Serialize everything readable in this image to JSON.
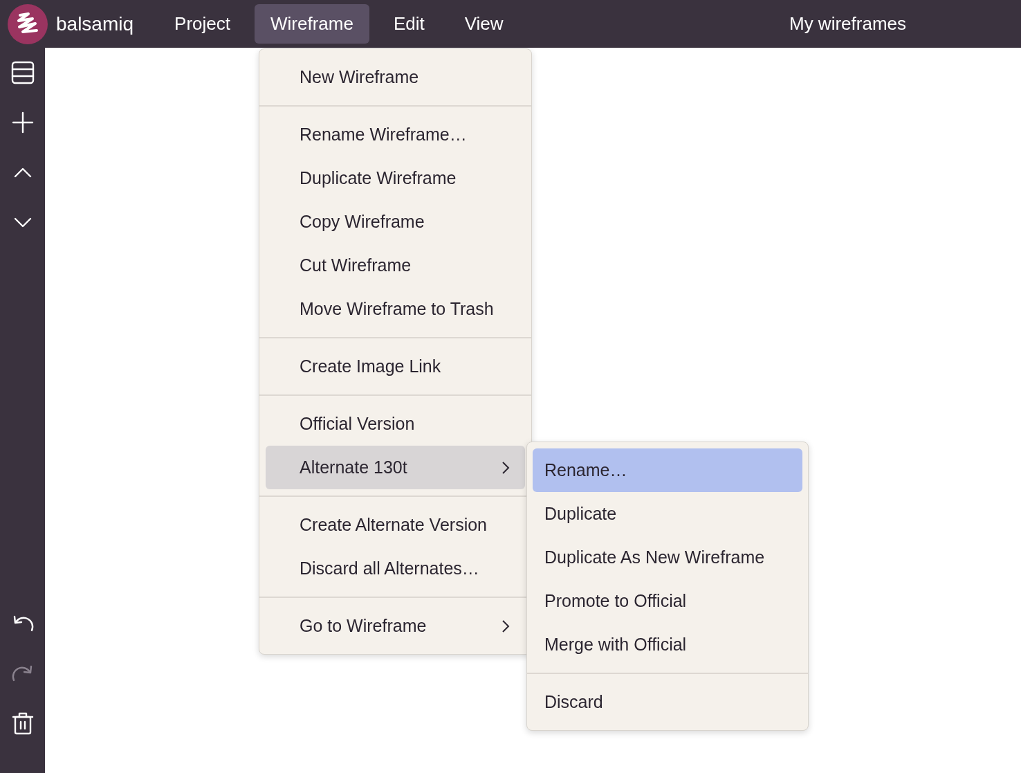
{
  "menubar": {
    "logo": "balsamiq",
    "menus": [
      {
        "label": "Project",
        "selected": false
      },
      {
        "label": "Wireframe",
        "selected": true
      },
      {
        "label": "Edit",
        "selected": false
      },
      {
        "label": "View",
        "selected": false
      }
    ],
    "title": "My wireframes"
  },
  "sidebar": {
    "top": [
      {
        "kind": "list",
        "disabled": false
      },
      {
        "kind": "add",
        "disabled": false
      },
      {
        "kind": "up",
        "disabled": false
      },
      {
        "kind": "down",
        "disabled": false
      }
    ],
    "bottom": [
      {
        "kind": "undo",
        "disabled": false
      },
      {
        "kind": "redo",
        "disabled": true
      },
      {
        "kind": "trash",
        "disabled": false
      }
    ]
  },
  "menu": {
    "groups": [
      [
        {
          "label": "New Wireframe",
          "selected": false,
          "submenu": false
        }
      ],
      [
        {
          "label": "Rename Wireframe…",
          "selected": false,
          "submenu": false
        },
        {
          "label": "Duplicate Wireframe",
          "selected": false,
          "submenu": false
        },
        {
          "label": "Copy Wireframe",
          "selected": false,
          "submenu": false
        },
        {
          "label": "Cut Wireframe",
          "selected": false,
          "submenu": false
        },
        {
          "label": "Move Wireframe to Trash",
          "selected": false,
          "submenu": false
        }
      ],
      [
        {
          "label": "Create Image Link",
          "selected": false,
          "submenu": false
        }
      ],
      [
        {
          "label": "Official Version",
          "selected": false,
          "submenu": false
        },
        {
          "label": "Alternate 130t",
          "selected": true,
          "submenu": true
        }
      ],
      [
        {
          "label": "Create Alternate Version",
          "selected": false,
          "submenu": false
        },
        {
          "label": "Discard all Alternates…",
          "selected": false,
          "submenu": false
        }
      ],
      [
        {
          "label": "Go to Wireframe",
          "selected": false,
          "submenu": true
        }
      ]
    ]
  },
  "submenu": {
    "groups": [
      [
        {
          "label": "Rename…",
          "selected": true
        },
        {
          "label": "Duplicate",
          "selected": false
        },
        {
          "label": "Duplicate As New Wireframe",
          "selected": false
        },
        {
          "label": "Promote to Official",
          "selected": false
        },
        {
          "label": "Merge with Official",
          "selected": false
        }
      ],
      [
        {
          "label": "Discard",
          "selected": false
        }
      ]
    ]
  }
}
